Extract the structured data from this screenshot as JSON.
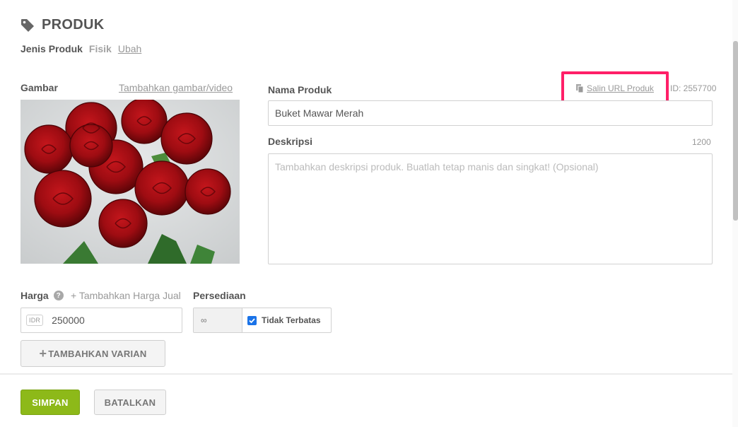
{
  "header": {
    "title": "PRODUK",
    "icon": "tag-icon"
  },
  "product_type": {
    "label": "Jenis Produk",
    "value": "Fisik",
    "change_link": "Ubah"
  },
  "image_section": {
    "label": "Gambar",
    "add_link": "Tambahkan gambar/video",
    "image_alt": "Buket Mawar Merah"
  },
  "name_field": {
    "label": "Nama Produk",
    "copy_url_link": "Salin URL Produk",
    "product_id": "ID: 2557700",
    "value": "Buket Mawar Merah"
  },
  "description_field": {
    "label": "Deskripsi",
    "char_count": "1200",
    "placeholder": "Tambahkan deskripsi produk. Buatlah tetap manis dan singkat! (Opsional)"
  },
  "price_field": {
    "label": "Harga",
    "help_icon": "?",
    "add_sale_price": "+ Tambahkan Harga Jual",
    "currency": "IDR",
    "value": "250000"
  },
  "stock_field": {
    "label": "Persediaan",
    "quantity": "∞",
    "unlimited_label": "Tidak Terbatas",
    "unlimited_checked": true
  },
  "variant_button": {
    "icon": "+",
    "label": "TAMBAHKAN VARIAN"
  },
  "footer": {
    "save_label": "SIMPAN",
    "cancel_label": "BATALKAN"
  },
  "colors": {
    "save_green": "#8db919",
    "highlight_pink": "#ff1f68",
    "checkbox_blue": "#1a73e8"
  }
}
